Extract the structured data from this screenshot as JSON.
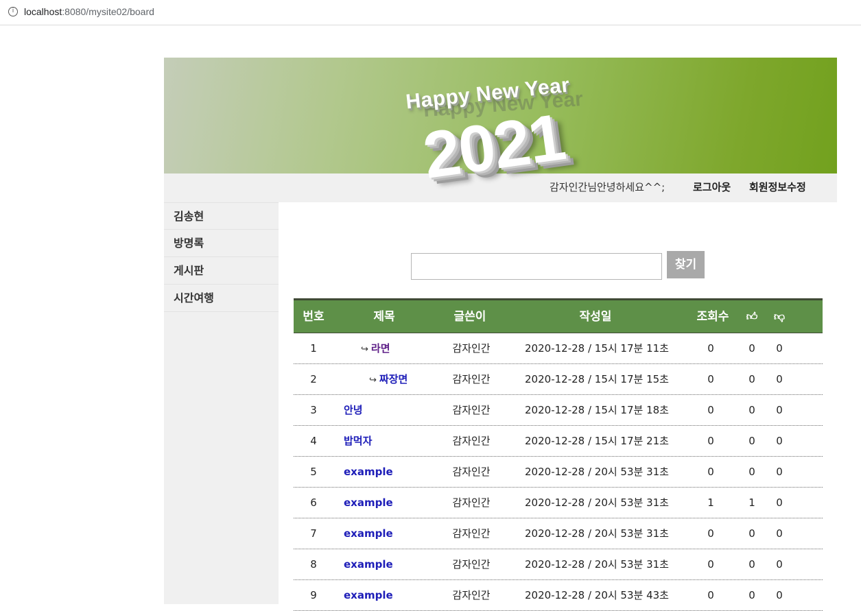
{
  "browser": {
    "url_host": "localhost",
    "url_rest": ":8080/mysite02/board",
    "info_icon": "info-icon"
  },
  "banner": {
    "headline": "Happy New Year",
    "year": "2021"
  },
  "userbar": {
    "greeting": "감자인간님안녕하세요^^;",
    "logout": "로그아웃",
    "edit_profile": "회원정보수정"
  },
  "sidebar": {
    "items": [
      {
        "label": "김송현"
      },
      {
        "label": "방명록"
      },
      {
        "label": "게시판"
      },
      {
        "label": "시간여행"
      }
    ]
  },
  "search": {
    "value": "",
    "button": "찾기"
  },
  "board": {
    "headers": {
      "no": "번호",
      "title": "제목",
      "author": "글쓴이",
      "date": "작성일",
      "views": "조회수",
      "like_icon": "thumbs-up-icon",
      "dislike_icon": "thumbs-down-icon"
    },
    "reply_arrow": "↪",
    "rows": [
      {
        "no": "1",
        "depth": 1,
        "visited": true,
        "title": "라면",
        "author": "감자인간",
        "date": "2020-12-28 / 15시 17분 11초",
        "views": "0",
        "likes": "0",
        "dislikes": "0"
      },
      {
        "no": "2",
        "depth": 2,
        "visited": false,
        "title": "짜장면",
        "author": "감자인간",
        "date": "2020-12-28 / 15시 17분 15초",
        "views": "0",
        "likes": "0",
        "dislikes": "0"
      },
      {
        "no": "3",
        "depth": 0,
        "visited": false,
        "title": "안녕",
        "author": "감자인간",
        "date": "2020-12-28 / 15시 17분 18초",
        "views": "0",
        "likes": "0",
        "dislikes": "0"
      },
      {
        "no": "4",
        "depth": 0,
        "visited": false,
        "title": "밥먹자",
        "author": "감자인간",
        "date": "2020-12-28 / 15시 17분 21초",
        "views": "0",
        "likes": "0",
        "dislikes": "0"
      },
      {
        "no": "5",
        "depth": 0,
        "visited": false,
        "title": "example",
        "author": "감자인간",
        "date": "2020-12-28 / 20시 53분 31초",
        "views": "0",
        "likes": "0",
        "dislikes": "0"
      },
      {
        "no": "6",
        "depth": 0,
        "visited": false,
        "title": "example",
        "author": "감자인간",
        "date": "2020-12-28 / 20시 53분 31초",
        "views": "1",
        "likes": "1",
        "dislikes": "0"
      },
      {
        "no": "7",
        "depth": 0,
        "visited": false,
        "title": "example",
        "author": "감자인간",
        "date": "2020-12-28 / 20시 53분 31초",
        "views": "0",
        "likes": "0",
        "dislikes": "0"
      },
      {
        "no": "8",
        "depth": 0,
        "visited": false,
        "title": "example",
        "author": "감자인간",
        "date": "2020-12-28 / 20시 53분 31초",
        "views": "0",
        "likes": "0",
        "dislikes": "0"
      },
      {
        "no": "9",
        "depth": 0,
        "visited": false,
        "title": "example",
        "author": "감자인간",
        "date": "2020-12-28 / 20시 53분 43초",
        "views": "0",
        "likes": "0",
        "dislikes": "0"
      }
    ]
  }
}
